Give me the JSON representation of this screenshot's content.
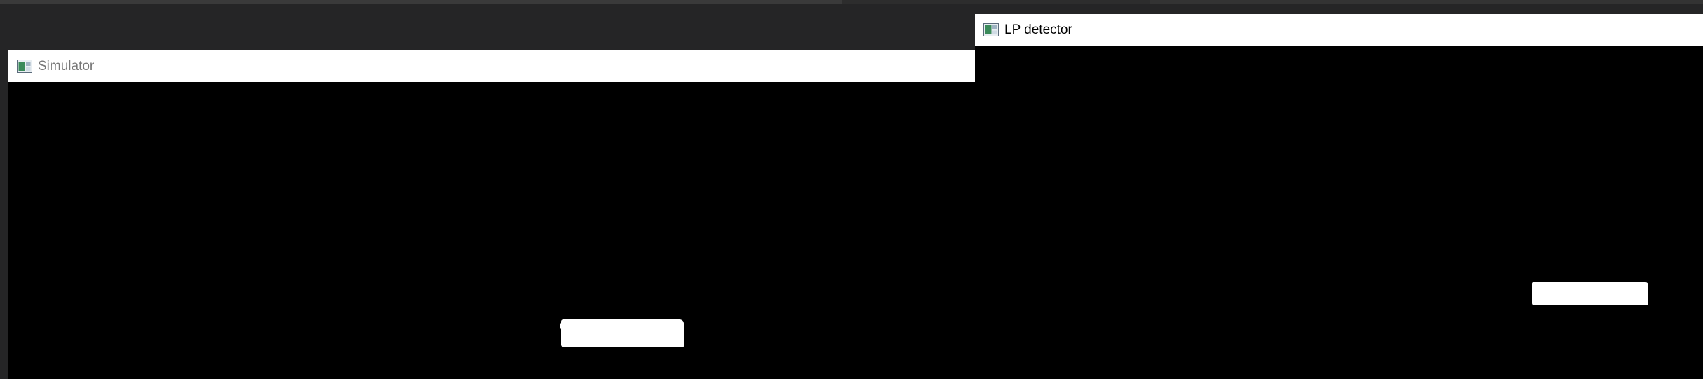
{
  "windows": {
    "simulator": {
      "title": "Simulator",
      "icon": "app-window-icon"
    },
    "lp_detector": {
      "title": "LP detector",
      "icon": "app-window-icon"
    }
  },
  "colors": {
    "desktop": "#252526",
    "titlebar": "#ffffff",
    "canvas": "#000000",
    "detection": "#ffffff",
    "icon_green": "#3a8a5a",
    "icon_frame": "#5b6b7b"
  }
}
